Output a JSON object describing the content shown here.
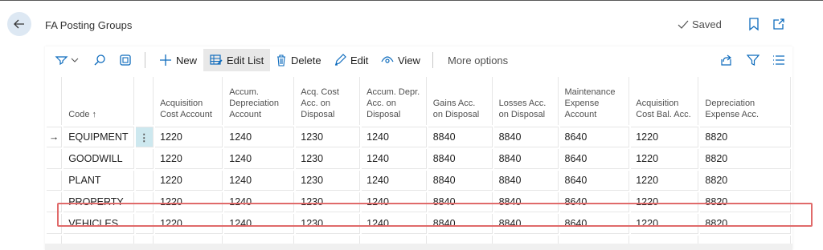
{
  "header": {
    "title": "FA Posting Groups",
    "saved_label": "Saved"
  },
  "toolbar": {
    "new_label": "New",
    "edit_list_label": "Edit List",
    "delete_label": "Delete",
    "edit_label": "Edit",
    "view_label": "View",
    "more_label": "More options"
  },
  "table": {
    "columns": [
      "Code ↑",
      "Acquisition Cost Account",
      "Accum. Depreciation Account",
      "Acq. Cost Acc. on Disposal",
      "Accum. Depr. Acc. on Disposal",
      "Gains Acc. on Disposal",
      "Losses Acc. on Disposal",
      "Maintenance Expense Account",
      "Acquisition Cost Bal. Acc.",
      "Depreciation Expense Acc."
    ],
    "rows": [
      [
        "EQUIPMENT",
        "1220",
        "1240",
        "1230",
        "1240",
        "8840",
        "8840",
        "8640",
        "1220",
        "8820"
      ],
      [
        "GOODWILL",
        "1220",
        "1240",
        "1230",
        "1240",
        "8840",
        "8840",
        "8640",
        "1220",
        "8820"
      ],
      [
        "PLANT",
        "1220",
        "1240",
        "1230",
        "1240",
        "8840",
        "8840",
        "8640",
        "1220",
        "8820"
      ],
      [
        "PROPERTY",
        "1220",
        "1240",
        "1230",
        "1240",
        "8840",
        "8840",
        "8640",
        "1220",
        "8820"
      ],
      [
        "VEHICLES",
        "1220",
        "1240",
        "1230",
        "1240",
        "8840",
        "8840",
        "8640",
        "1220",
        "8820"
      ]
    ],
    "selected_row_marker": "→",
    "row_menu_glyph": "⋮"
  },
  "colors": {
    "accent": "#0f6cbd",
    "highlight_border": "#e06a6a",
    "selected_cell": "#cde8ef"
  }
}
